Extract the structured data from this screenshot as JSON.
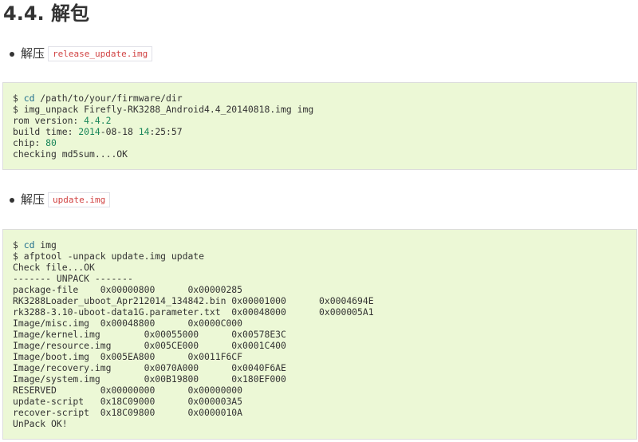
{
  "heading": {
    "text": "4.4. 解包"
  },
  "items": [
    {
      "label": "解压",
      "code": "release_update.img"
    },
    {
      "label": "解压",
      "code": "update.img"
    }
  ],
  "block1": {
    "lines": [
      [
        {
          "t": "$ "
        },
        {
          "t": "cd",
          "c": "cmd"
        },
        {
          "t": " /path/to/your/firmware/dir"
        }
      ],
      [
        {
          "t": "$ img_unpack Firefly-RK3288_Android4.4_20140818.img img"
        }
      ],
      [
        {
          "t": "rom version: "
        },
        {
          "t": "4.4.2",
          "c": "num"
        }
      ],
      [
        {
          "t": "build time: "
        },
        {
          "t": "2014",
          "c": "num"
        },
        {
          "t": "-08-18 "
        },
        {
          "t": "14",
          "c": "num"
        },
        {
          "t": ":25:57"
        }
      ],
      [
        {
          "t": "chip: "
        },
        {
          "t": "80",
          "c": "num"
        }
      ],
      [
        {
          "t": "checking md5sum....OK"
        }
      ]
    ]
  },
  "block2": {
    "lines": [
      [
        {
          "t": "$ "
        },
        {
          "t": "cd",
          "c": "cmd"
        },
        {
          "t": " img"
        }
      ],
      [
        {
          "t": "$ afptool -unpack update.img update"
        }
      ],
      [
        {
          "t": "Check file...OK"
        }
      ],
      [
        {
          "t": "------- UNPACK -------"
        }
      ],
      [
        {
          "t": "package-file    0x00000800      0x00000285"
        }
      ],
      [
        {
          "t": "RK3288Loader_uboot_Apr212014_134842.bin 0x00001000      0x0004694E"
        }
      ],
      [
        {
          "t": "rk3288-3.10-uboot-data1G.parameter.txt  0x00048000      0x000005A1"
        }
      ],
      [
        {
          "t": "Image/misc.img  0x00048800      0x0000C000"
        }
      ],
      [
        {
          "t": "Image/kernel.img        0x00055000      0x00578E3C"
        }
      ],
      [
        {
          "t": "Image/resource.img      0x005CE000      0x0001C400"
        }
      ],
      [
        {
          "t": "Image/boot.img  0x005EA800      0x0011F6CF"
        }
      ],
      [
        {
          "t": "Image/recovery.img      0x0070A000      0x0040F6AE"
        }
      ],
      [
        {
          "t": "Image/system.img        0x00B19800      0x180EF000"
        }
      ],
      [
        {
          "t": "RESERVED        0x00000000      0x00000000"
        }
      ],
      [
        {
          "t": "update-script   0x18C09000      0x000003A5"
        }
      ],
      [
        {
          "t": "recover-script  0x18C09800      0x0000010A"
        }
      ],
      [
        {
          "t": "UnPack OK!"
        }
      ]
    ]
  },
  "colors": {
    "code_background": "#ecf8d6",
    "inline_code_text": "#d14343",
    "command_keyword": "#1e6d8c",
    "number_literal": "#19865a"
  }
}
